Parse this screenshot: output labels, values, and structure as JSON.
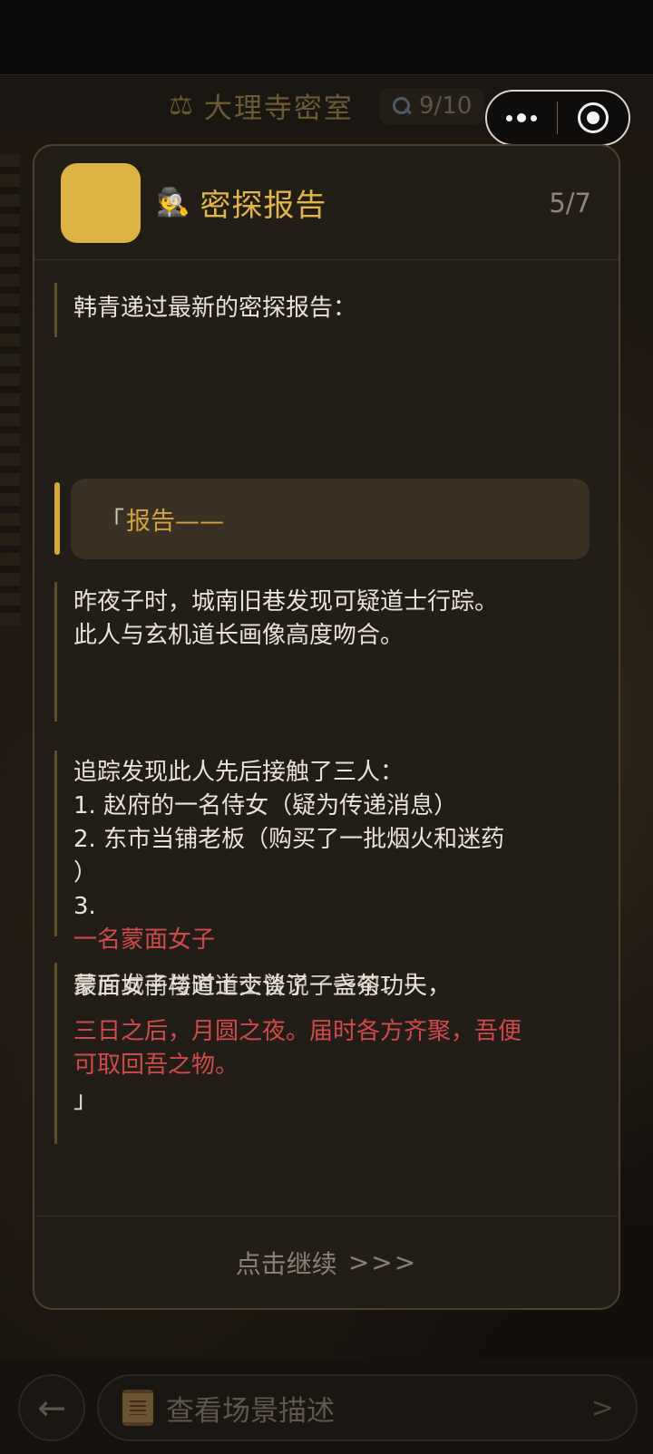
{
  "game": {
    "title": "大理寺密室",
    "clue_count": "9/10"
  },
  "capsule": {
    "more_icon": "more-dots-icon",
    "close_icon": "target-close-icon"
  },
  "modal": {
    "title": "密探报告",
    "title_icon": "🕵️",
    "page": "5/7",
    "intro": "韩青递过最新的密探报告：",
    "report_bracket": "「",
    "report_label": "报告——",
    "paragraph_1": "昨夜子时，城南旧巷发现可疑道士行踪。\n此人与玄机道长画像高度吻合。",
    "paragraph_2": "追踪发现此人先后接触了三人：\n1. 赵府的一名侍女（疑为传递消息）\n2. 东市当铺老板（购买了一批烟火和迷药\n）\n3.",
    "paragraph_2_red": "一名蒙面女子",
    "overlap_text_a": "蒙面女子与道士交谈了一盏茶功夫，",
    "overlap_text_b": "最后城南楼时道士曾说了一句：「",
    "quote": "三日之后，月圆之夜。届时各方齐聚，吾便可取回吾之物。",
    "quote_close": "」",
    "continue_label": "点击继续",
    "continue_arrows": ">>>"
  },
  "bottom": {
    "back_icon": "←",
    "scene_label": "查看场景描述",
    "scene_arrow": ">"
  },
  "colors": {
    "accent_gold": "#e0b549",
    "alert_red": "#cf4b4b",
    "panel_bg": "#221d17"
  }
}
